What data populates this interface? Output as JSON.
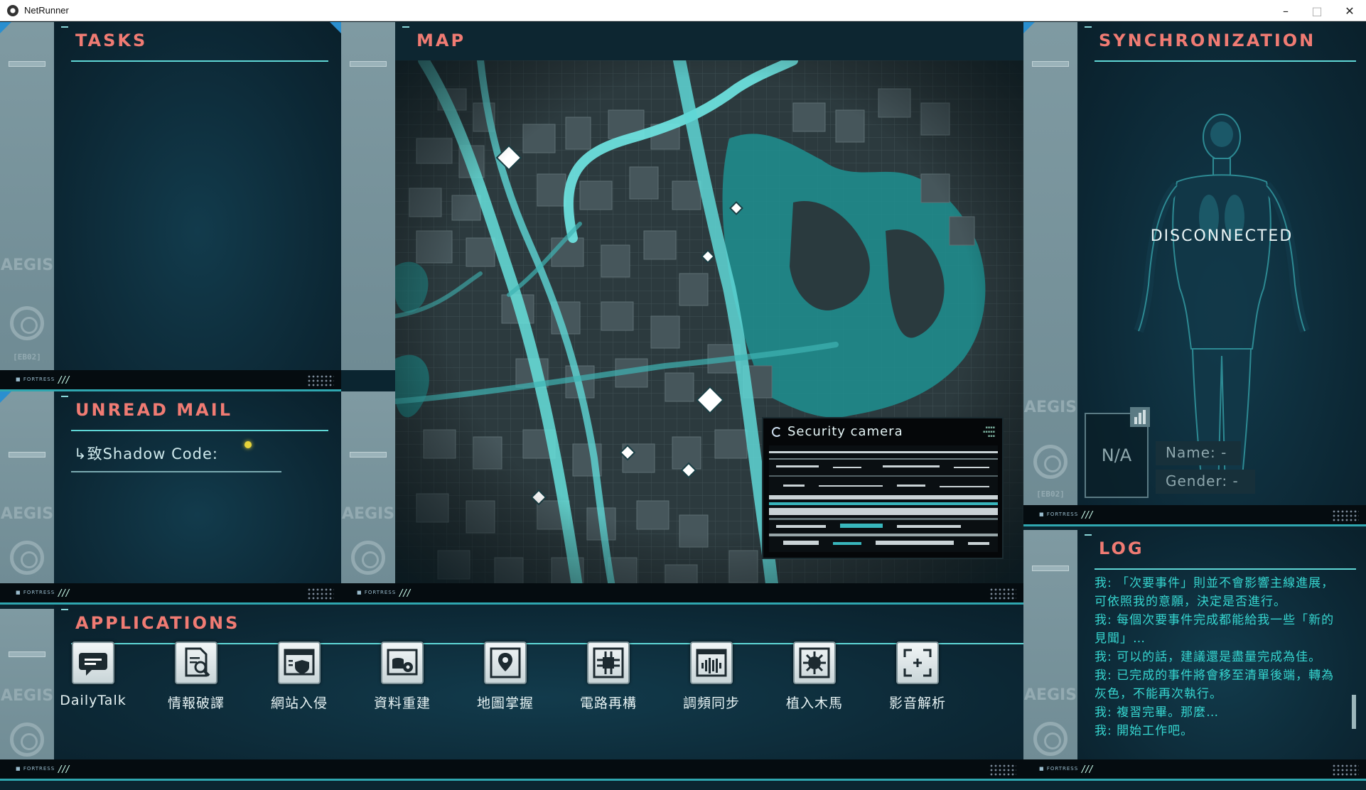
{
  "window": {
    "title": "NetRunner",
    "min_glyph": "–",
    "max_glyph": "□",
    "close_glyph": "✕"
  },
  "tasks": {
    "title": "TASKS"
  },
  "mail": {
    "title": "UNREAD MAIL",
    "items": [
      {
        "label": "↳致Shadow Code:",
        "unread": true
      }
    ]
  },
  "map": {
    "title": "MAP",
    "camera": {
      "title": "Security camera"
    }
  },
  "sync": {
    "title": "SYNCHRONIZATION",
    "status": "DISCONNECTED",
    "na_label": "N/A",
    "name_field": "Name: -",
    "gender_field": "Gender: -"
  },
  "log": {
    "title": "LOG",
    "lines": [
      "我: 「次要事件」則並不會影響主線進展，可依照我的意願，決定是否進行。",
      "我: 每個次要事件完成都能給我一些「新的見聞」…",
      "我: 可以的話，建議還是盡量完成為佳。",
      "我: 已完成的事件將會移至清單後端，轉為灰色，不能再次執行。",
      "我: 複習完畢。那麼…",
      "我: 開始工作吧。"
    ]
  },
  "applications": {
    "title": "APPLICATIONS",
    "items": [
      {
        "label": "DailyTalk",
        "icon": "chat-icon"
      },
      {
        "label": "情報破譯",
        "icon": "document-search-icon"
      },
      {
        "label": "網站入侵",
        "icon": "web-shield-icon"
      },
      {
        "label": "資料重建",
        "icon": "database-gear-icon"
      },
      {
        "label": "地圖掌握",
        "icon": "map-pin-icon"
      },
      {
        "label": "電路再構",
        "icon": "circuit-chip-icon"
      },
      {
        "label": "調頻同步",
        "icon": "audio-wave-icon"
      },
      {
        "label": "植入木馬",
        "icon": "virus-icon"
      },
      {
        "label": "影音解析",
        "icon": "focus-frame-icon"
      }
    ]
  },
  "decor": {
    "aegis": "AEGIS",
    "eb_label": "[EB02]",
    "footer_brand": "■ FORTRESS",
    "footer_slashes": "///"
  },
  "colors": {
    "title_coral": "#f07b73",
    "accent_cyan": "#5fd7d6",
    "log_text": "#36d6d0",
    "panel_bg": "#0c2734"
  }
}
